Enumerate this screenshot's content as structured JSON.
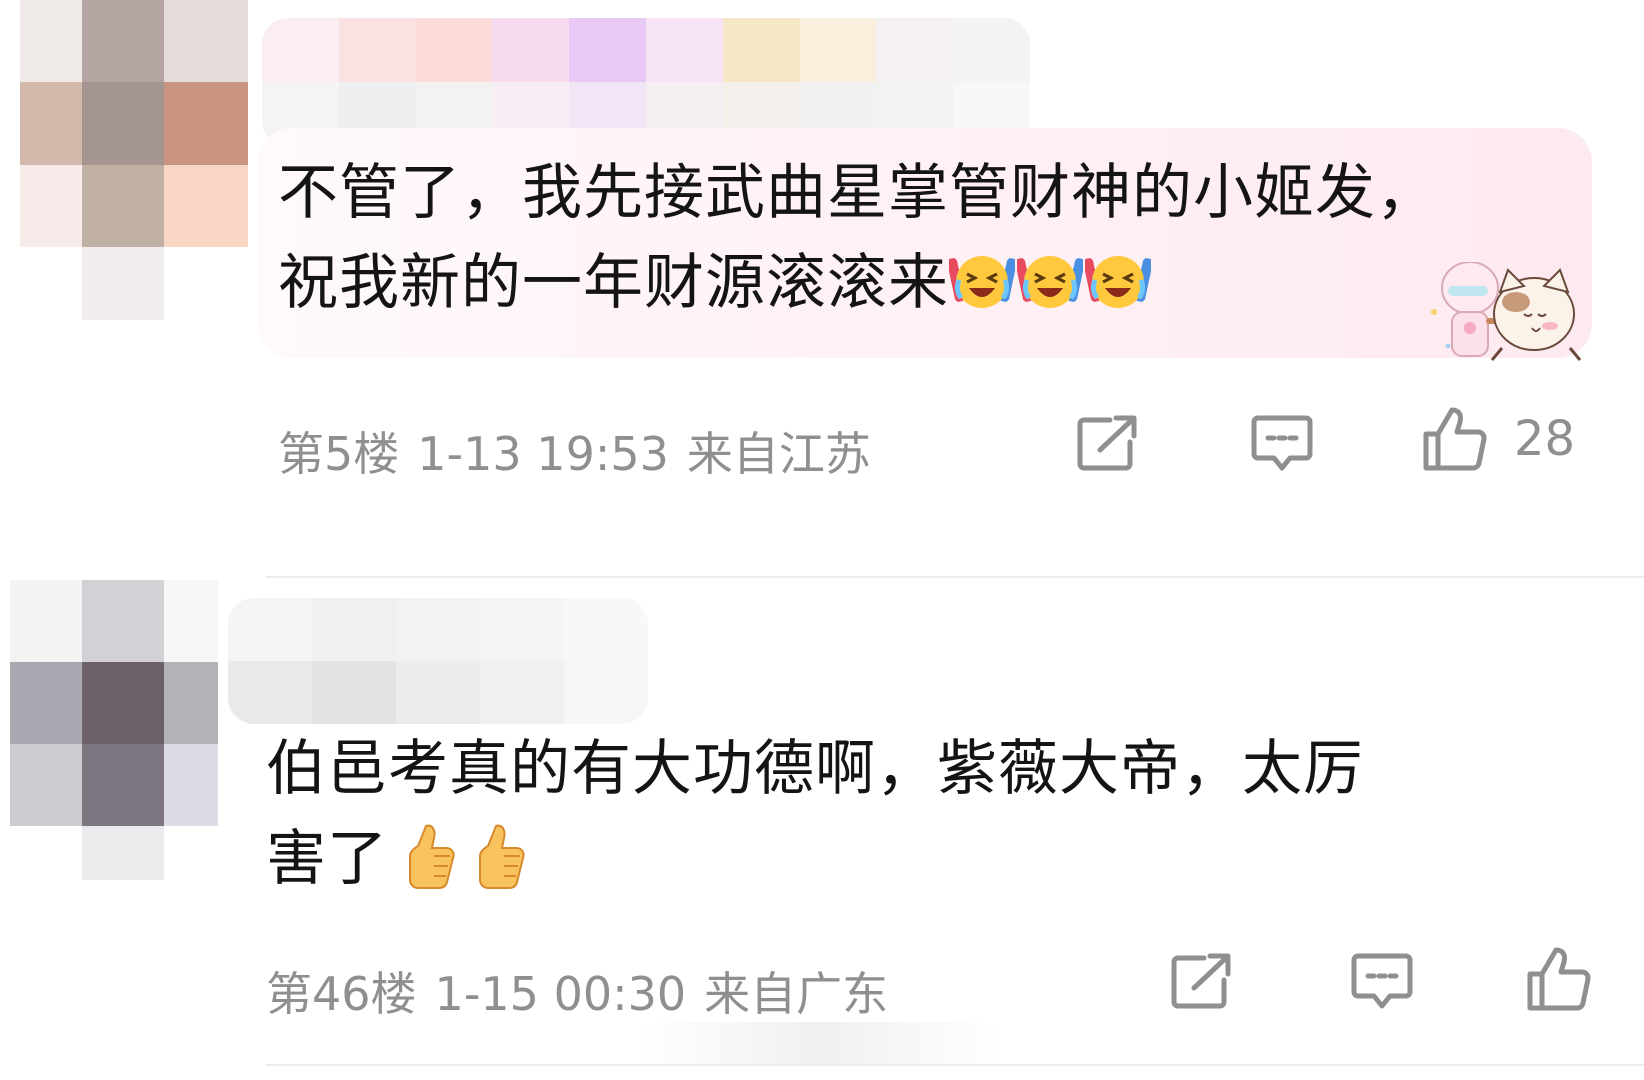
{
  "comments": [
    {
      "text_lines": [
        "不管了，我先接武曲星掌管财神的小姬发，",
        "祝我新的一年财源滚滚来"
      ],
      "emojis": [
        "laughing-crying-emoji",
        "laughing-crying-emoji",
        "laughing-crying-emoji"
      ],
      "floor": "第5楼",
      "time": "1-13 19:53",
      "location": "来自江苏",
      "likes": "28",
      "bubble_colors": [
        "#fff9fb",
        "#fdeaf0"
      ]
    },
    {
      "text_lines": [
        "伯邑考真的有大功德啊，紫薇大帝，太厉",
        "害了"
      ],
      "emojis": [
        "thumbs-up-emoji",
        "thumbs-up-emoji"
      ],
      "floor": "第46楼",
      "time": "1-15 00:30",
      "location": "来自广东",
      "likes": ""
    }
  ],
  "icons": {
    "share": "share-icon",
    "reply": "comment-icon",
    "like": "thumbs-up-icon"
  },
  "colors": {
    "meta_text": "#8f8f8f",
    "icon_stroke": "#8f8f8f",
    "avatar_1": [
      "#efe9e8",
      "#b5a5a2",
      "#e6dcda",
      "#d3b8ac",
      "#a59590",
      "#c99482",
      "#f7ecea",
      "#c0b1a4",
      "#f7d6c4",
      "#ffffff",
      "#f3eeee",
      "#ffffff"
    ],
    "avatar_2": [
      "#f3f3f3",
      "#d2d1d5",
      "#f6f6f6",
      "#a9a8b0",
      "#6c6169",
      "#b3b2b8",
      "#cdcbd0",
      "#7e7680",
      "#dddce4",
      "#ffffff",
      "#ebebee",
      "#ffffff"
    ],
    "username_1": [
      "#fbeef0",
      "#fbe1e2",
      "#fbdcd8",
      "#f7dcef",
      "#e8c8f4",
      "#f6e3f4",
      "#f5e6c4",
      "#f8f0dc",
      "#f5f1f2",
      "#f3f3f3",
      "#f4f4f4",
      "#efefef",
      "#f2f2f2",
      "#f6eef4",
      "#f0e6f6",
      "#f5eff3",
      "#f3f0ec",
      "#f1f1f1",
      "#f2f2f2",
      "#f7f7f7"
    ],
    "username_2": [
      "#f5f5f5",
      "#f0f0f0",
      "#f2f2f2",
      "#f4f4f4",
      "#f8f8f8",
      "#e9e9e9",
      "#e3e3e3",
      "#ececec",
      "#f0f0f0",
      "#f6f6f6"
    ]
  }
}
